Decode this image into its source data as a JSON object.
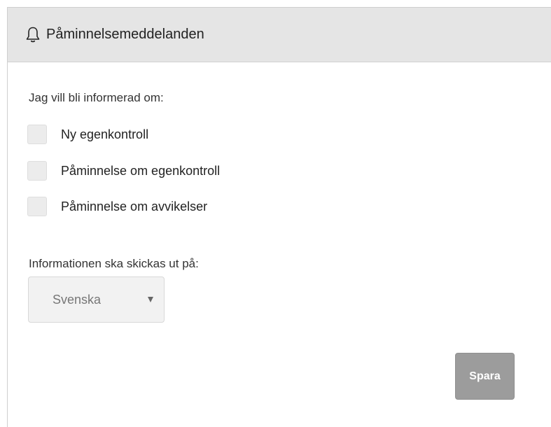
{
  "panel": {
    "title": "Påminnelsemeddelanden",
    "icon": "bell-icon"
  },
  "notifications": {
    "intro": "Jag vill bli informerad om:",
    "options": [
      {
        "label": "Ny egenkontroll",
        "checked": false
      },
      {
        "label": "Påminnelse om egenkontroll",
        "checked": false
      },
      {
        "label": "Påminnelse om avvikelser",
        "checked": false
      }
    ]
  },
  "language": {
    "label": "Informationen ska skickas ut på:",
    "selected": "Svenska"
  },
  "actions": {
    "save_label": "Spara"
  }
}
